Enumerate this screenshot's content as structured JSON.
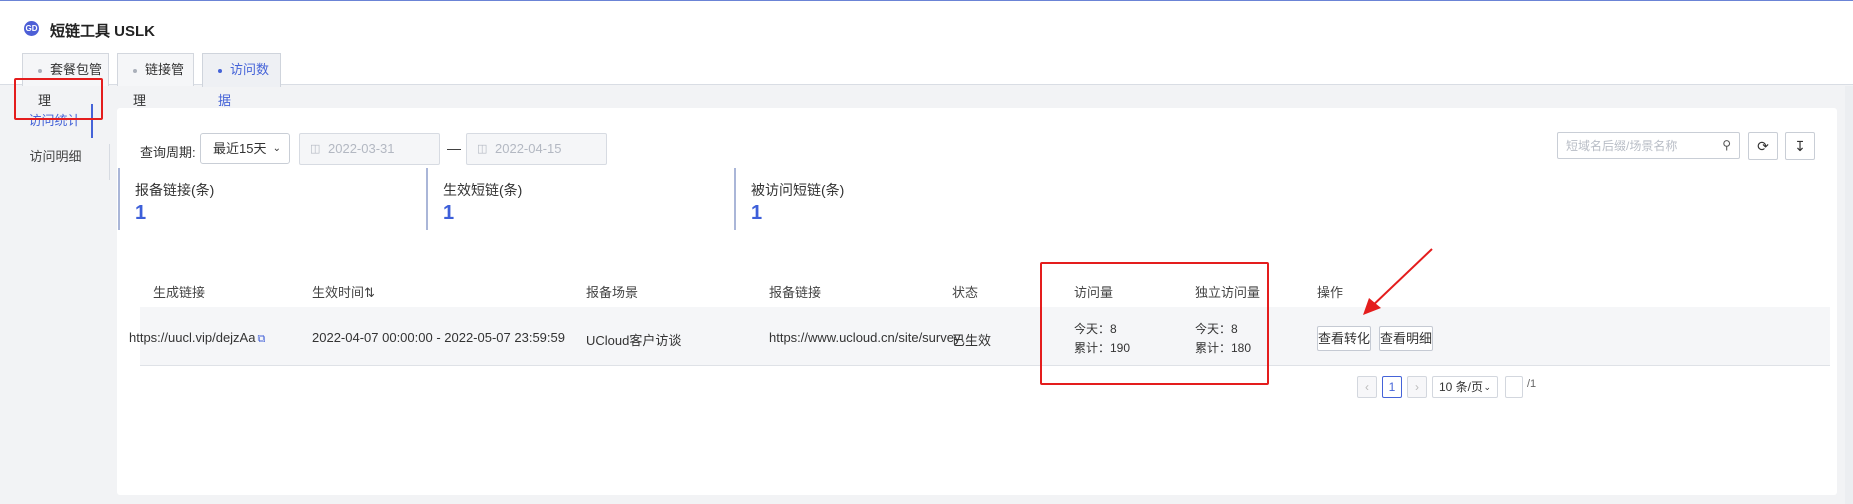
{
  "app": {
    "title": "短链工具 USLK",
    "logo_icon": "link-icon",
    "logo_text": "GD"
  },
  "tabs": [
    {
      "label": "套餐包管理",
      "active": false
    },
    {
      "label": "链接管理",
      "active": false
    },
    {
      "label": "访问数据",
      "active": true
    }
  ],
  "sidebar": {
    "items": [
      {
        "label": "访问统计",
        "active": true
      },
      {
        "label": "访问明细",
        "active": false
      }
    ]
  },
  "filter": {
    "period_label": "查询周期:",
    "period_value": "最近15天",
    "start_date": "2022-03-31",
    "end_date": "2022-04-15",
    "separator": "—",
    "search_placeholder": "短域名后缀/场景名称"
  },
  "stats": [
    {
      "label": "报备链接(条)",
      "value": "1"
    },
    {
      "label": "生效短链(条)",
      "value": "1"
    },
    {
      "label": "被访问短链(条)",
      "value": "1"
    }
  ],
  "table": {
    "columns": [
      "生成链接",
      "生效时间",
      "报备场景",
      "报备链接",
      "状态",
      "访问量",
      "独立访问量",
      "操作"
    ],
    "sort_icon": "⇅",
    "rows": [
      {
        "link": "https://uucl.vip/dejzAa",
        "time": "2022-04-07 00:00:00 - 2022-05-07 23:59:59",
        "scene": "UCloud客户访谈",
        "report_link": "https://www.ucloud.cn/site/survey…",
        "status": "已生效",
        "visits_today": "今天：8",
        "visits_total": "累计：190",
        "unique_today": "今天：8",
        "unique_total": "累计：180",
        "action_conversion": "查看转化",
        "action_detail": "查看明细"
      }
    ]
  },
  "pagination": {
    "prev": "‹",
    "current": "1",
    "next": "›",
    "page_size": "10 条/页",
    "total_pages": "/1"
  },
  "annotations": {
    "highlight_color": "#e41d1d"
  }
}
